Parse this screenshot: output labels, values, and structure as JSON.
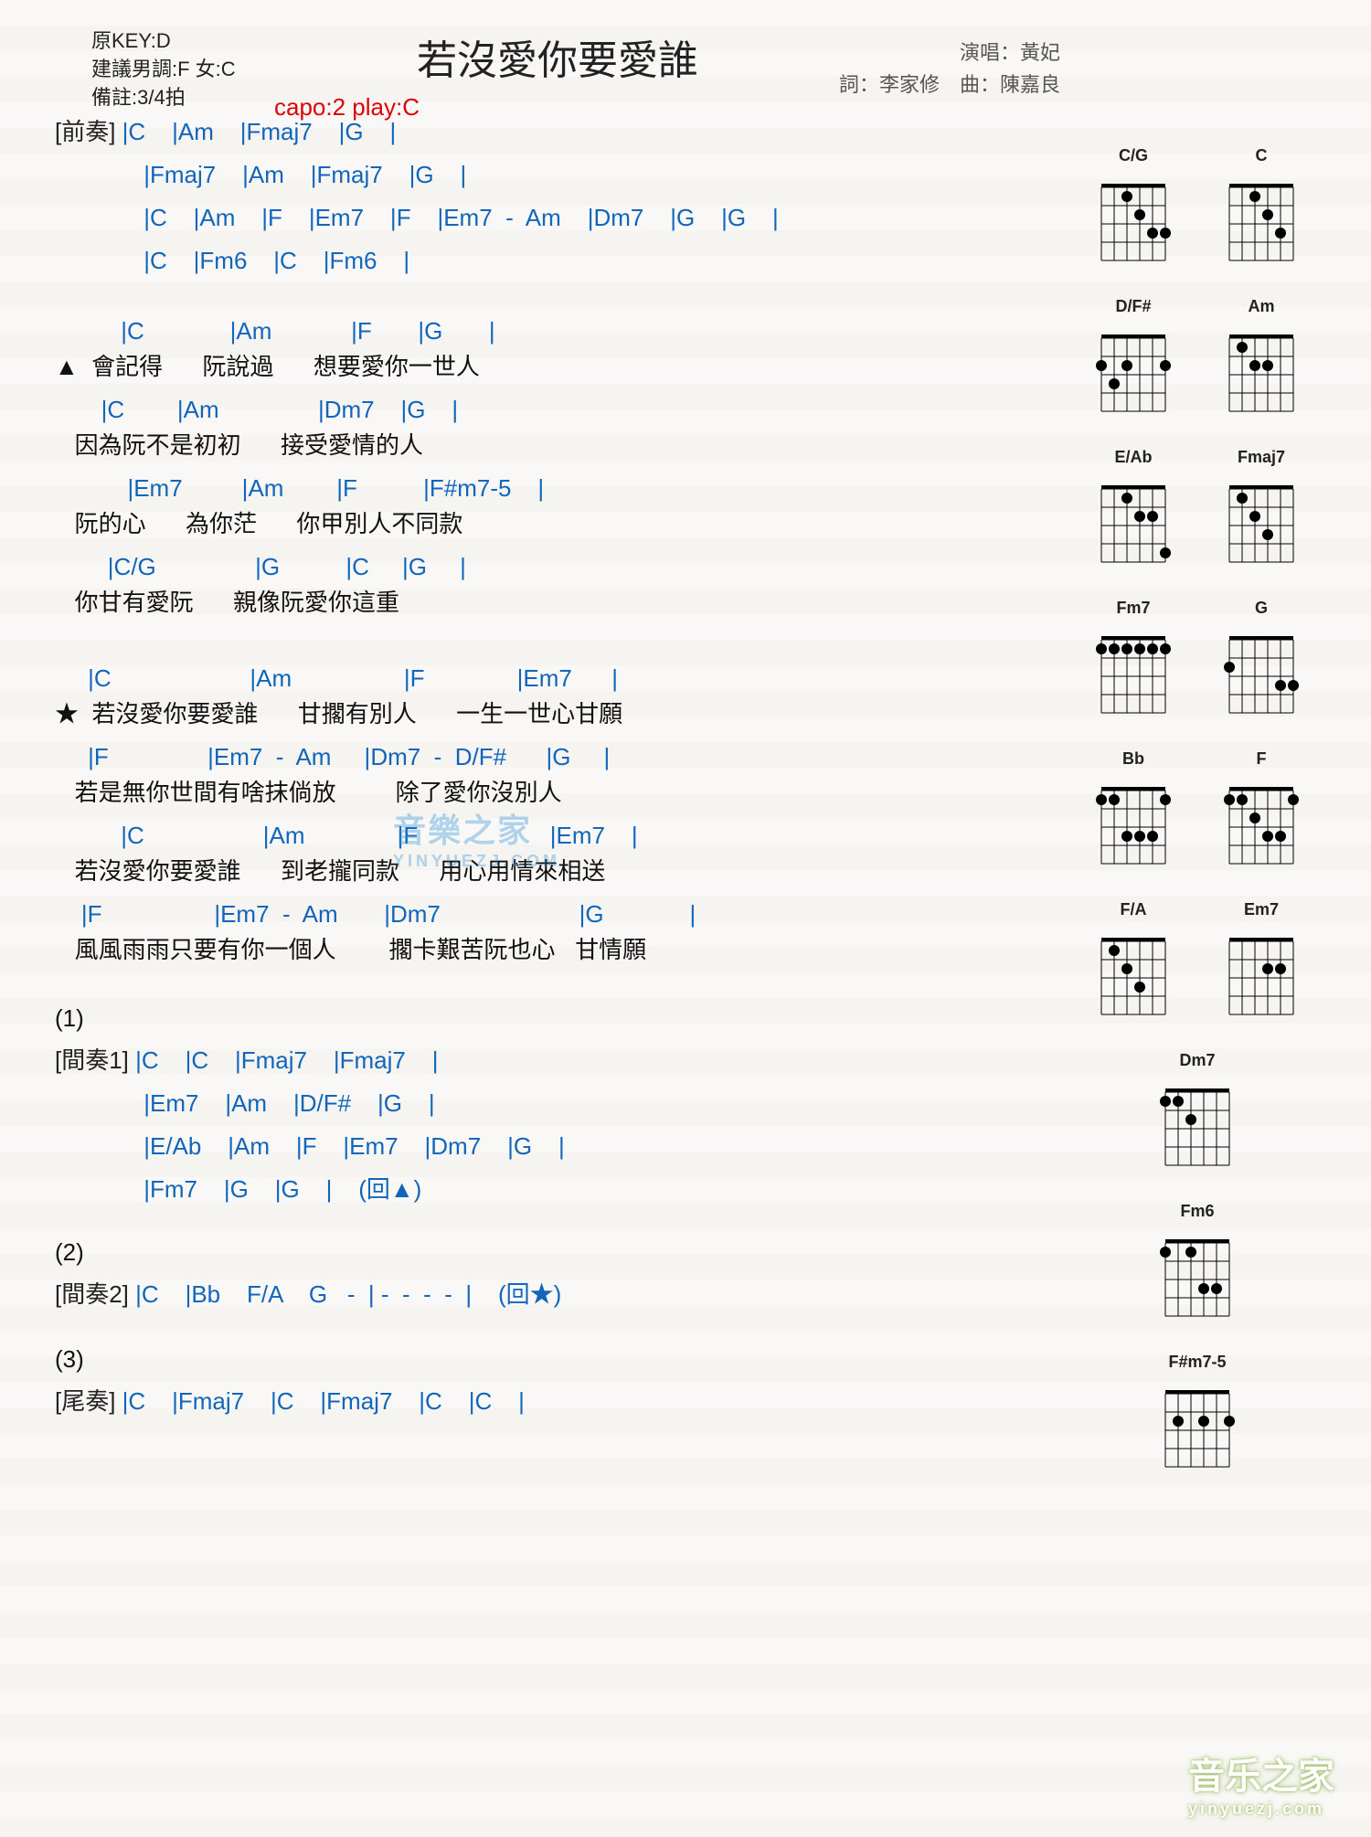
{
  "header": {
    "title": "若沒愛你要愛誰",
    "original_key": "原KEY:D",
    "suggested": "建議男調:F 女:C",
    "note": "備註:3/4拍",
    "capo": "capo:2 play:C",
    "singer_label": "演唱：",
    "singer": "黃妃",
    "lyricist_label": "詞：",
    "lyricist": "李家修",
    "composer_label": "曲：",
    "composer": "陳嘉良"
  },
  "sections": {
    "intro_label": "[前奏]",
    "intro_lines": [
      " |C    |Am    |Fmaj7    |G    |",
      " |Fmaj7    |Am    |Fmaj7    |G    |",
      " |C    |Am    |F    |Em7    |F    |Em7  -  Am    |Dm7    |G    |G    |",
      " |C    |Fm6    |C    |Fm6    |"
    ],
    "verse_mark": "▲",
    "verse": [
      {
        "chords": "          |C             |Am            |F       |G       |",
        "lyrics": "  會記得      阮說過      想要愛你一世人"
      },
      {
        "chords": "       |C        |Am               |Dm7    |G    |",
        "lyrics": "   因為阮不是初初      接受愛情的人"
      },
      {
        "chords": "           |Em7         |Am        |F          |F#m7-5    |",
        "lyrics": "   阮的心      為你茫      你甲別人不同款"
      },
      {
        "chords": "        |C/G               |G          |C     |G     |",
        "lyrics": "   你甘有愛阮      親像阮愛你這重"
      }
    ],
    "chorus_mark": "★",
    "chorus": [
      {
        "chords": "     |C                     |Am                 |F              |Em7      |",
        "lyrics": "  若沒愛你要愛誰      甘擱有別人      一生一世心甘願"
      },
      {
        "chords": "     |F               |Em7  -  Am     |Dm7  -  D/F#      |G     |",
        "lyrics": "   若是無你世間有啥抹倘放         除了愛你沒別人"
      },
      {
        "chords": "          |C                  |Am              |F                    |Em7    |",
        "lyrics": "   若沒愛你要愛誰      到老攏同款      用心用情來相送"
      },
      {
        "chords": "    |F                 |Em7  -  Am       |Dm7                     |G             |",
        "lyrics": "   風風雨雨只要有你一個人        擱卡艱苦阮也心   甘情願"
      }
    ],
    "repeat1_label": "(1)",
    "interlude1_label": "[間奏1]",
    "interlude1_lines": [
      " |C    |C    |Fmaj7    |Fmaj7    |",
      " |Em7    |Am    |D/F#    |G    |",
      " |E/Ab    |Am    |F    |Em7    |Dm7    |G    |",
      " |Fm7    |G    |G    |    (回▲)"
    ],
    "repeat2_label": "(2)",
    "interlude2_label": "[間奏2]",
    "interlude2_line": " |C    |Bb    F/A    G   -  | -  -  -  -  |    (回★)",
    "repeat3_label": "(3)",
    "outro_label": "[尾奏]",
    "outro_line": " |C    |Fmaj7    |C    |Fmaj7    |C    |C    |"
  },
  "diagrams": [
    [
      "C/G",
      "C"
    ],
    [
      "D/F#",
      "Am"
    ],
    [
      "E/Ab",
      "Fmaj7"
    ],
    [
      "Fm7",
      "G"
    ],
    [
      "Bb",
      "F"
    ],
    [
      "F/A",
      "Em7"
    ],
    [
      "Dm7"
    ],
    [
      "Fm6"
    ],
    [
      "F#m7-5"
    ]
  ],
  "watermark": {
    "main": "音樂之家",
    "sub": "YINYUEZJ.COM"
  },
  "footer_wm": {
    "main": "音乐之家",
    "sub": "yinyuezj.com"
  }
}
